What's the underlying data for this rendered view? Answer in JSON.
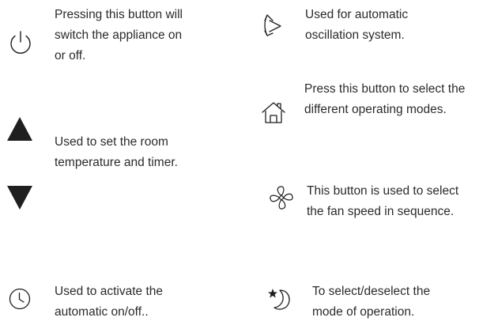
{
  "items": {
    "power": {
      "icon": "power-icon",
      "lines": [
        "Pressing this button will",
        "switch the appliance on",
        "or off."
      ]
    },
    "oscillation": {
      "icon": "oscillation-icon",
      "lines": [
        "Used for automatic",
        "oscillation system."
      ]
    },
    "mode": {
      "icon": "home-mode-icon",
      "lines": [
        "Press this button to select the",
        "different operating modes."
      ]
    },
    "temperature": {
      "icons": [
        "triangle-up-icon",
        "triangle-down-icon"
      ],
      "lines": [
        "Used to set the room",
        "temperature and timer."
      ]
    },
    "fan": {
      "icon": "fan-icon",
      "lines": [
        "This button is used to select",
        "the fan speed in sequence."
      ]
    },
    "timer": {
      "icon": "clock-icon",
      "lines": [
        "Used to activate the",
        "automatic on/off.."
      ]
    },
    "sleep": {
      "icon": "sleep-moon-star-icon",
      "lines": [
        "To select/deselect the",
        "mode of operation."
      ]
    }
  },
  "colors": {
    "text": "#2b2b2b",
    "icon": "#1f1f1f"
  }
}
